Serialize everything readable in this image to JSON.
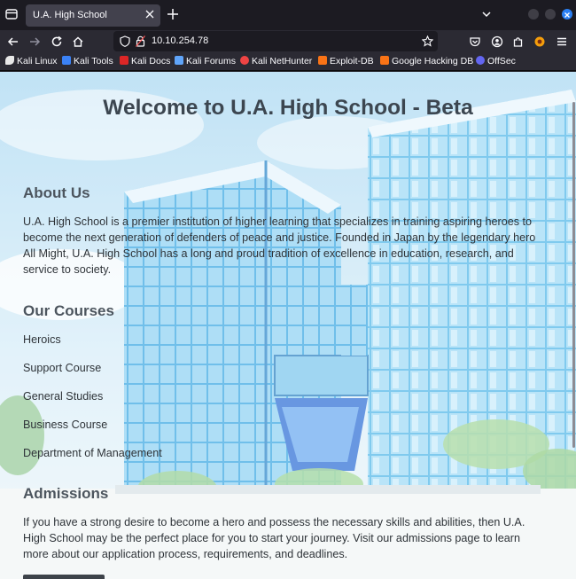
{
  "browser": {
    "tab": {
      "title": "U.A. High School"
    },
    "url": "10.10.254.78",
    "bookmarks": [
      {
        "label": "Kali Linux",
        "color": "#e8e8e8"
      },
      {
        "label": "Kali Tools",
        "color": "#3b82f6"
      },
      {
        "label": "Kali Docs",
        "color": "#dc2626"
      },
      {
        "label": "Kali Forums",
        "color": "#60a5fa"
      },
      {
        "label": "Kali NetHunter",
        "color": "#ef4444"
      },
      {
        "label": "Exploit-DB",
        "color": "#f97316"
      },
      {
        "label": "Google Hacking DB",
        "color": "#f97316"
      },
      {
        "label": "OffSec",
        "color": "#6366f1"
      }
    ]
  },
  "page": {
    "title": "Welcome to U.A. High School - Beta",
    "about": {
      "heading": "About Us",
      "text": "U.A. High School is a premier institution of higher learning that specializes in training aspiring heroes to become the next generation of defenders of peace and justice. Founded in Japan by the legendary hero All Might, U.A. High School has a long and proud tradition of excellence in education, research, and service to society."
    },
    "courses": {
      "heading": "Our Courses",
      "items": [
        "Heroics",
        "Support Course",
        "General Studies",
        "Business Course",
        "Department of Management"
      ]
    },
    "admissions": {
      "heading": "Admissions",
      "text": "If you have a strong desire to become a hero and possess the necessary skills and abilities, then U.A. High School may be the perfect place for you to start your journey. Visit our admissions page to learn more about our application process, requirements, and deadlines."
    }
  },
  "colors": {
    "chrome_dark": "#1c1b22",
    "chrome_toolbar": "#2b2a33",
    "accent_blue": "#2a7ff2",
    "heading_text": "#3c4650"
  }
}
